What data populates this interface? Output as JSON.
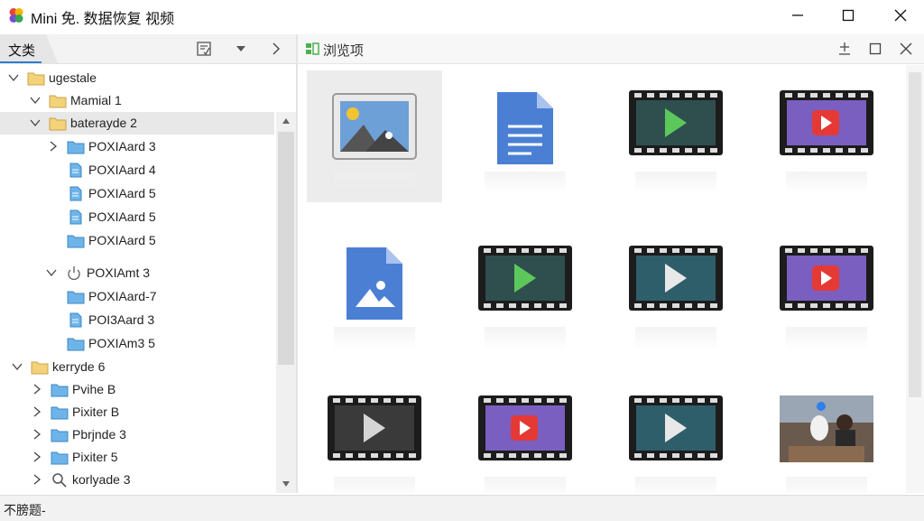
{
  "window": {
    "title": "Mini 免. 数据恢复 视频",
    "minimize_icon": "minimize-icon",
    "maximize_icon": "maximize-icon",
    "close_icon": "close-icon"
  },
  "left_panel": {
    "tab_label": "文类",
    "header_icons": [
      "checklist-icon",
      "dropdown-arrow-icon",
      "chevron-right-icon"
    ],
    "tree": [
      {
        "label": "ugestale",
        "icon": "folder-icon",
        "expander": "expanded"
      },
      {
        "label": "Mamial 1",
        "icon": "folder-icon",
        "expander": "expanded"
      },
      {
        "label": "baterayde 2",
        "icon": "folder-icon",
        "expander": "expanded",
        "selected": true
      },
      {
        "label": "POXIAard 3",
        "icon": "folder-blue-icon",
        "expander": "collapsed"
      },
      {
        "label": "POXIAard 4",
        "icon": "file-blue-icon",
        "expander": "none"
      },
      {
        "label": "POXIAard 5",
        "icon": "file-blue-icon",
        "expander": "none"
      },
      {
        "label": "POXIAard 5",
        "icon": "file-blue-icon",
        "expander": "none"
      },
      {
        "label": "POXIAard 5",
        "icon": "folder-blue-icon",
        "expander": "none"
      },
      {
        "label": "POXIAmt 3",
        "icon": "power-icon",
        "expander": "expanded"
      },
      {
        "label": "POXIAard-7",
        "icon": "folder-blue-icon",
        "expander": "none"
      },
      {
        "label": "POI3Aard 3",
        "icon": "file-blue-icon",
        "expander": "none"
      },
      {
        "label": "POXIAm3 5",
        "icon": "folder-blue-icon",
        "expander": "none"
      },
      {
        "label": "kerryde 6",
        "icon": "folder-icon",
        "expander": "expanded"
      },
      {
        "label": "Pvihe B",
        "icon": "folder-blue-icon",
        "expander": "collapsed"
      },
      {
        "label": "Pixiter B",
        "icon": "folder-blue-icon",
        "expander": "collapsed"
      },
      {
        "label": "Pbrjnde 3",
        "icon": "folder-blue-icon",
        "expander": "collapsed"
      },
      {
        "label": "Pixiter 5",
        "icon": "folder-blue-icon",
        "expander": "collapsed"
      },
      {
        "label": "korlyade 3",
        "icon": "search-icon",
        "expander": "collapsed"
      }
    ]
  },
  "right_panel": {
    "header_label": "浏览项",
    "header_icons": [
      "pin-icon",
      "restore-icon",
      "close-icon"
    ],
    "thumbnails": [
      {
        "kind": "image-file-icon",
        "selected": true
      },
      {
        "kind": "document-icon"
      },
      {
        "kind": "video-green-play-icon"
      },
      {
        "kind": "video-red-play-icon"
      },
      {
        "kind": "image-doc-icon"
      },
      {
        "kind": "video-green-play-icon"
      },
      {
        "kind": "video-teal-play-icon"
      },
      {
        "kind": "video-red-play-icon"
      },
      {
        "kind": "video-dark-play-icon"
      },
      {
        "kind": "video-red-play-icon"
      },
      {
        "kind": "video-teal-play-icon"
      },
      {
        "kind": "photo-thumbnail"
      }
    ]
  },
  "status": {
    "text": "不膀题-"
  },
  "colors": {
    "accent": "#2d7dd2",
    "folder_yellow": "#f3d27a",
    "folder_blue": "#5aa8e0"
  }
}
